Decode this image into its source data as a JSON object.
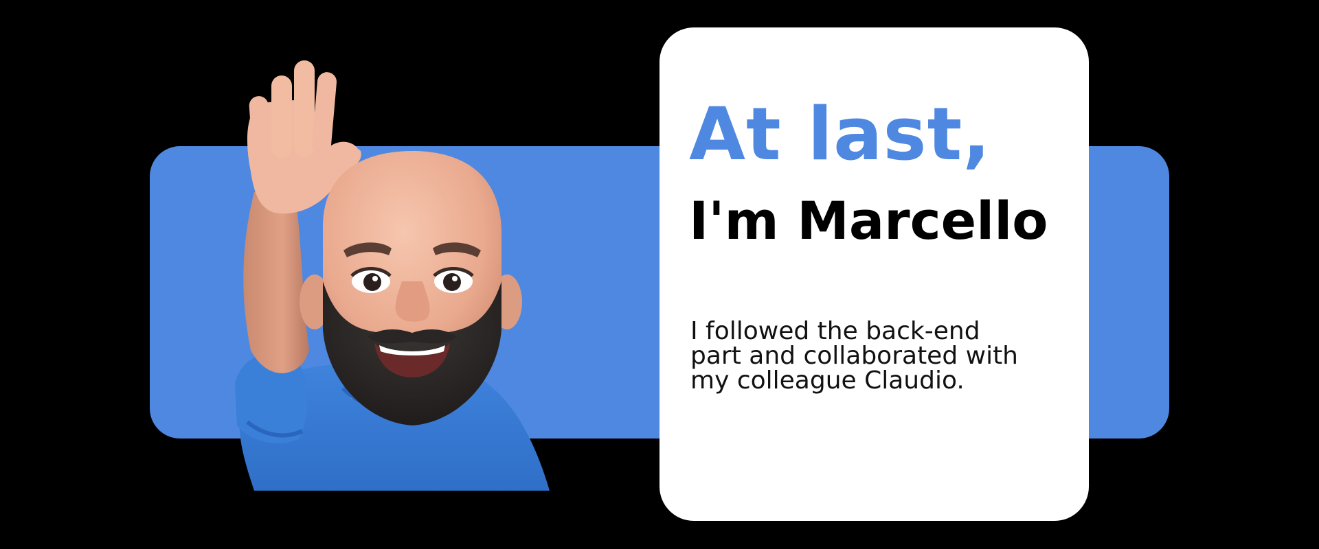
{
  "colors": {
    "background": "#000000",
    "accent_blue": "#4f88e0",
    "card": "#ffffff",
    "text_dark": "#000000"
  },
  "avatar": {
    "icon": "waving-memoji-avatar-icon"
  },
  "card": {
    "headline": "At last,",
    "name": "I'm Marcello",
    "bio": "I followed the back-end part and collaborated with my colleague Claudio."
  }
}
